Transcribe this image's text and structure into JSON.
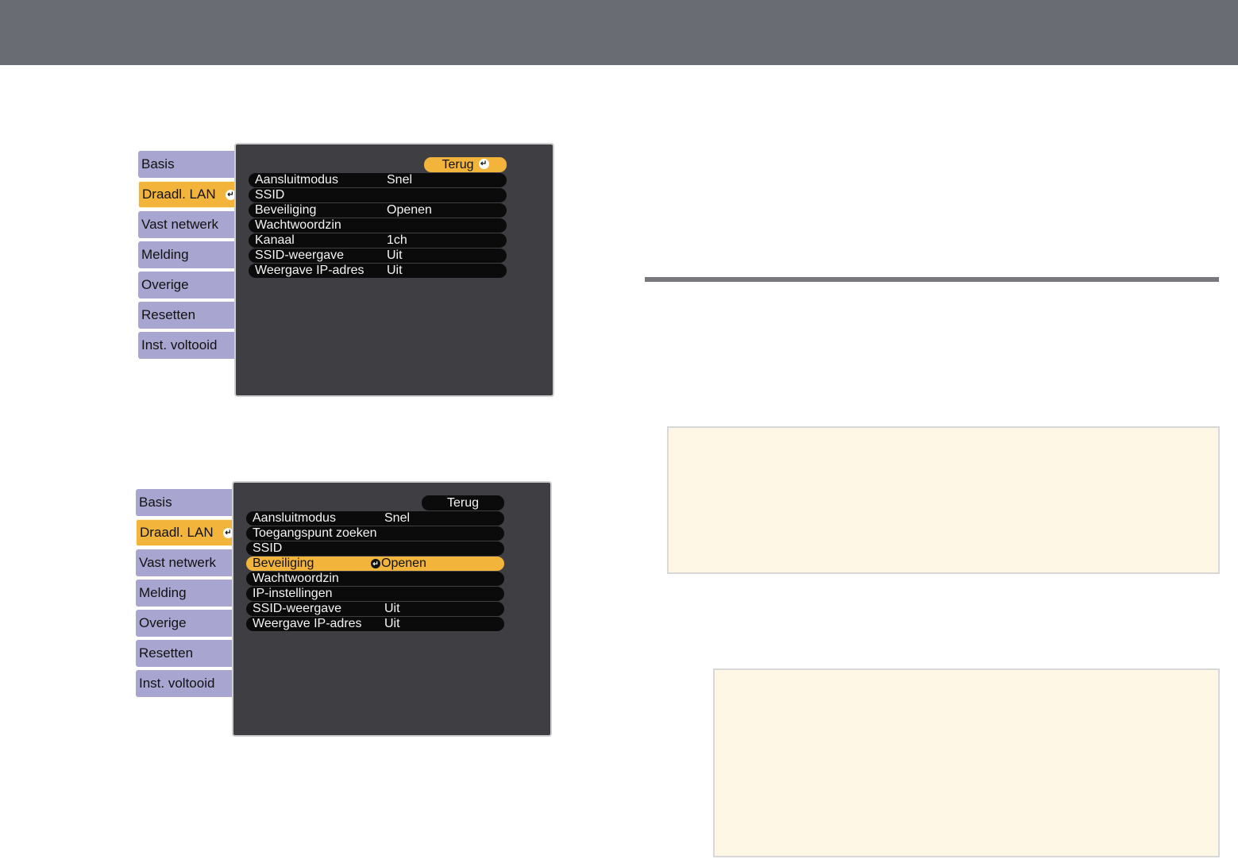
{
  "menu1": {
    "tabs": [
      "Basis",
      "Draadl. LAN",
      "Vast netwerk",
      "Melding",
      "Overige",
      "Resetten",
      "Inst. voltooid"
    ],
    "active_tab": "Draadl. LAN",
    "back_label": "Terug",
    "rows": [
      {
        "label": "Aansluitmodus",
        "value": "Snel"
      },
      {
        "label": "SSID",
        "value": ""
      },
      {
        "label": "Beveiliging",
        "value": "Openen"
      },
      {
        "label": "Wachtwoordzin",
        "value": ""
      },
      {
        "label": "Kanaal",
        "value": "1ch"
      },
      {
        "label": "SSID-weergave",
        "value": "Uit"
      },
      {
        "label": "Weergave IP-adres",
        "value": "Uit"
      }
    ]
  },
  "menu2": {
    "tabs": [
      "Basis",
      "Draadl. LAN",
      "Vast netwerk",
      "Melding",
      "Overige",
      "Resetten",
      "Inst. voltooid"
    ],
    "active_tab": "Draadl. LAN",
    "back_label": "Terug",
    "rows": [
      {
        "label": "Aansluitmodus",
        "value": "Snel"
      },
      {
        "label": "Toegangspunt zoeken",
        "value": ""
      },
      {
        "label": "SSID",
        "value": ""
      },
      {
        "label": "Beveiliging",
        "value": "Openen"
      },
      {
        "label": "Wachtwoordzin",
        "value": ""
      },
      {
        "label": "IP-instellingen",
        "value": ""
      },
      {
        "label": "SSID-weergave",
        "value": "Uit"
      },
      {
        "label": "Weergave IP-adres",
        "value": "Uit"
      }
    ],
    "selected_row": "Beveiliging"
  },
  "colors": {
    "header": "#6a6c73",
    "tab": "#a8a6d0",
    "highlight": "#f2b43a",
    "panel": "#3f3f43",
    "note_bg": "#fef7e6"
  },
  "icons": {
    "enter": "enter-icon"
  }
}
